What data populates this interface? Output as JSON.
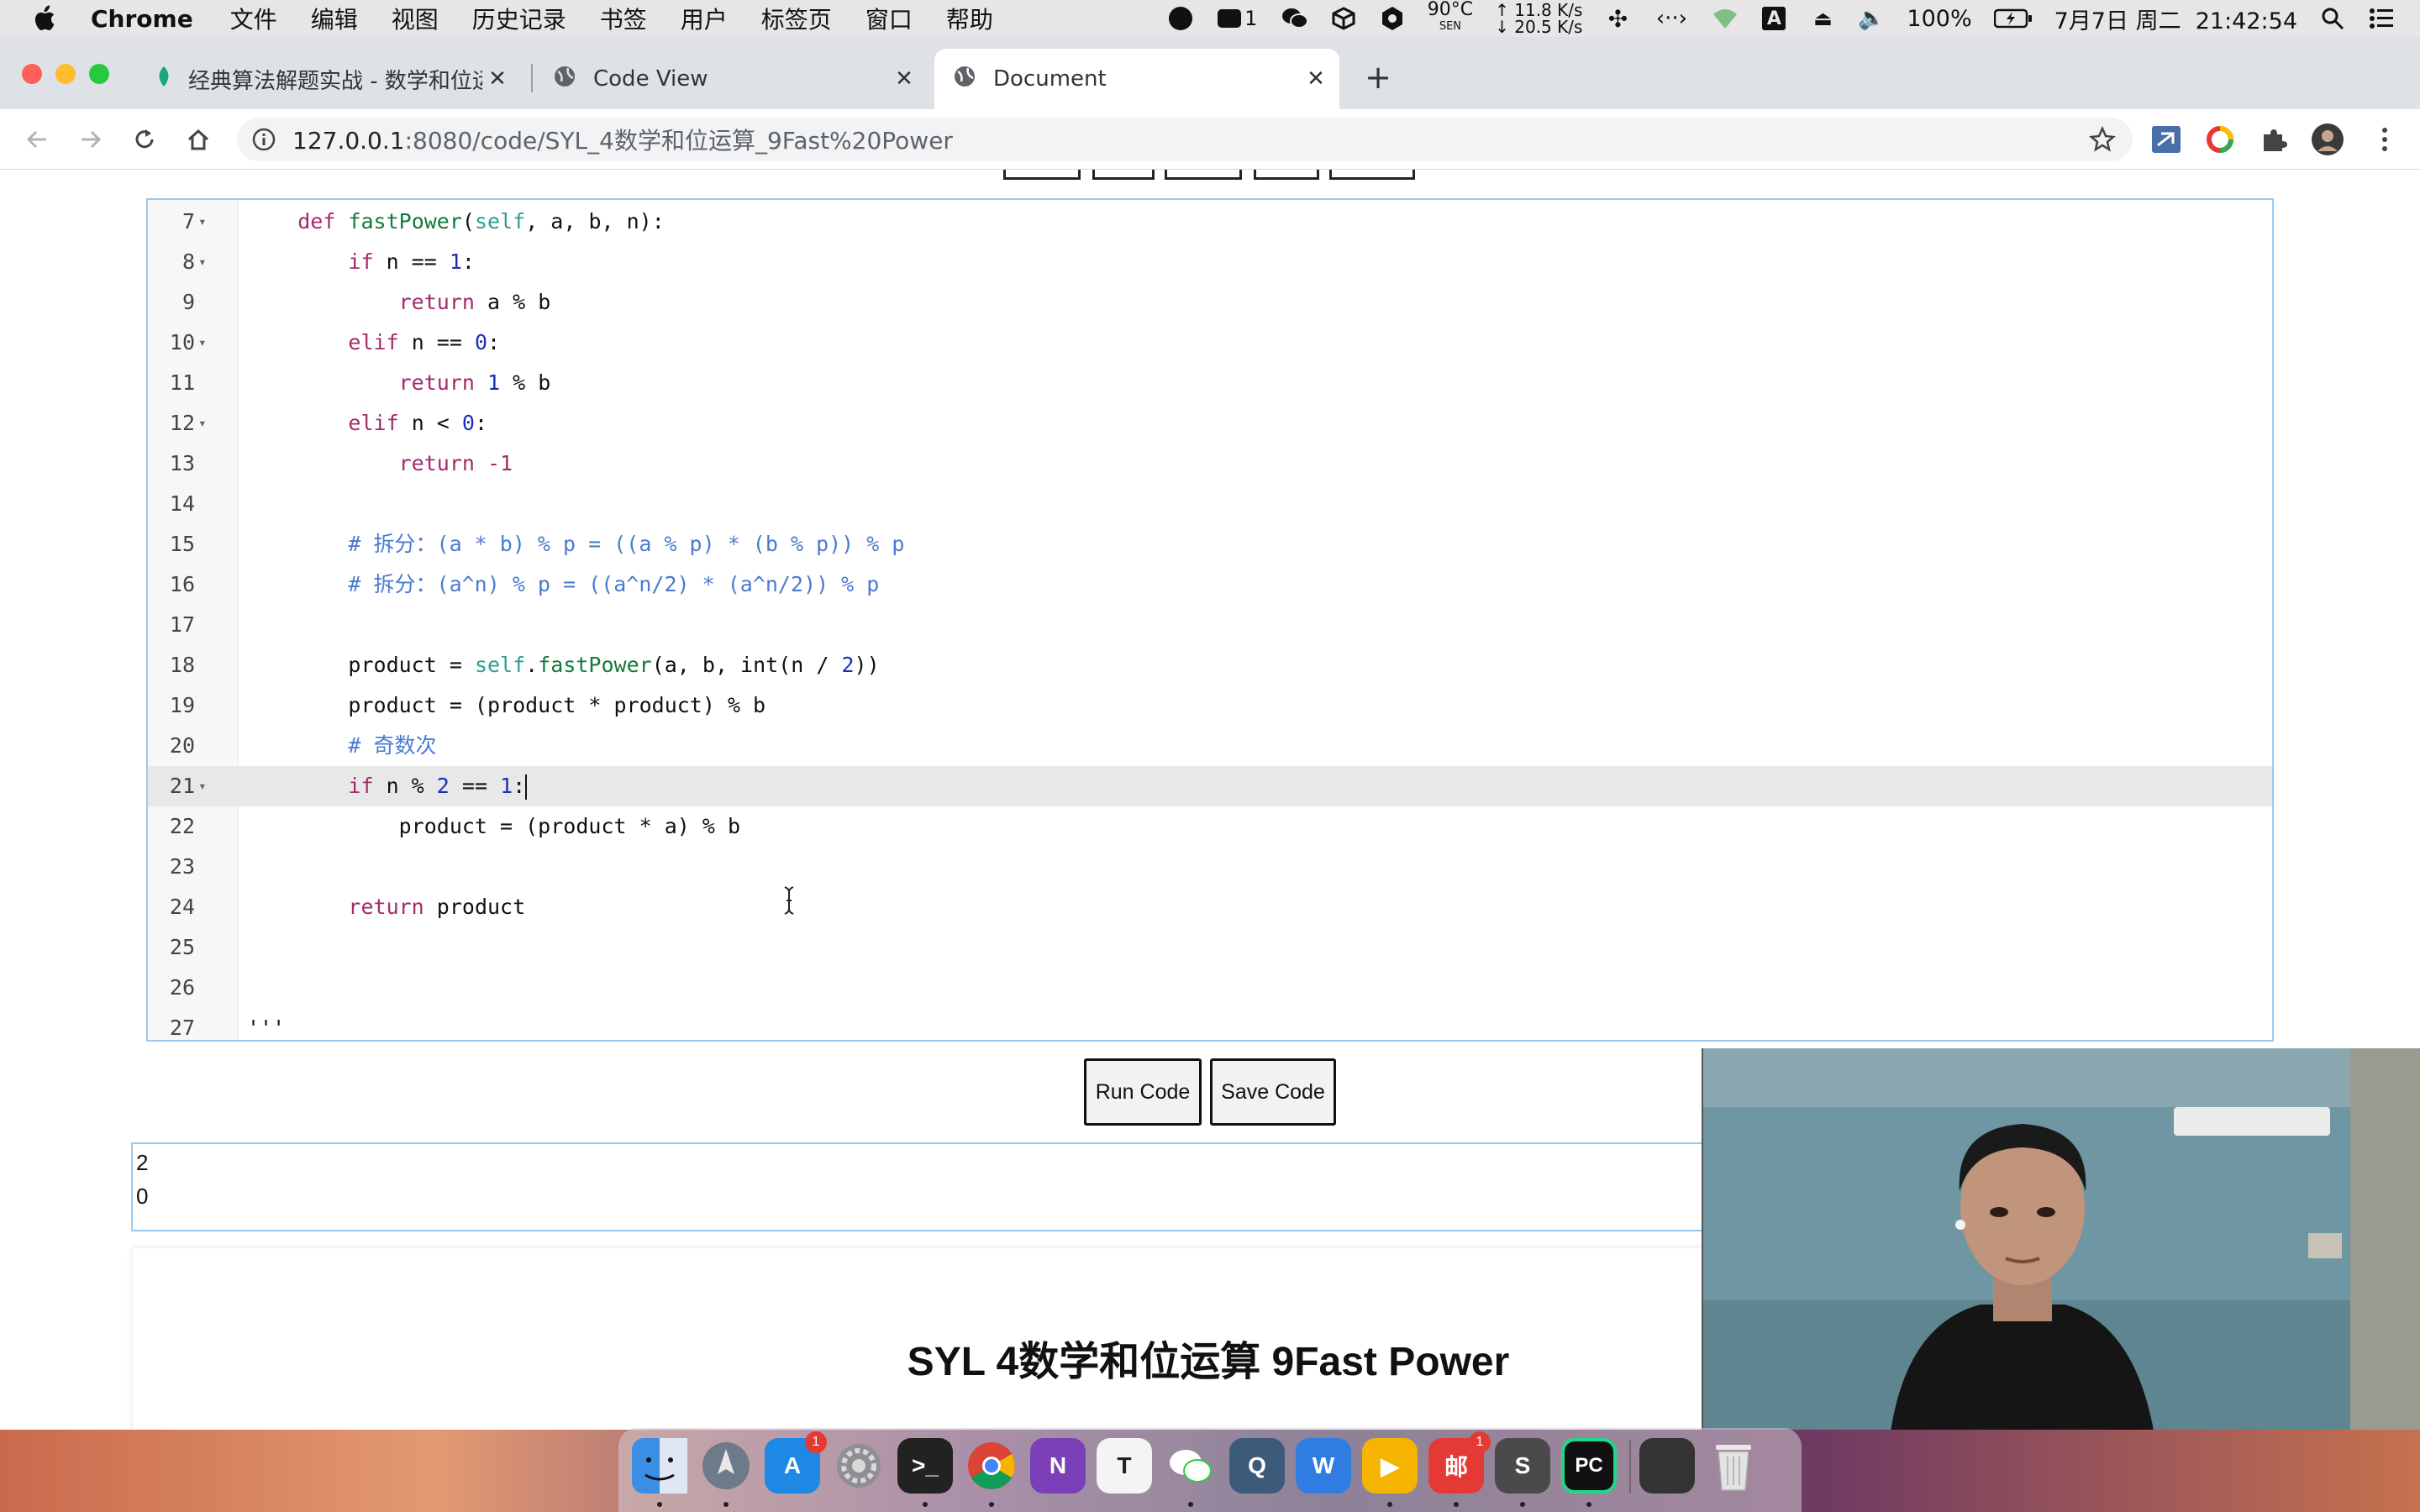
{
  "menubar": {
    "app_name": "Chrome",
    "menus": [
      "文件",
      "编辑",
      "视图",
      "历史记录",
      "书签",
      "用户",
      "标签页",
      "窗口",
      "帮助"
    ],
    "status": {
      "wechat_badge": "1",
      "temperature": "90°C",
      "temp_sensor": "SEN",
      "net_up": "11.8 K/s",
      "net_down": "20.5 K/s",
      "input_method": "A",
      "battery": "100%",
      "datetime": "7月7日 周二  21:42:54"
    }
  },
  "browser": {
    "tabs": [
      {
        "label": "经典算法解题实战 - 数学和位运算",
        "icon": "leaf-icon"
      },
      {
        "label": "Code View",
        "icon": "globe-icon"
      },
      {
        "label": "Document",
        "icon": "globe-icon",
        "active": true
      }
    ],
    "url_host": "127.0.0.1",
    "url_path": ":8080/code/SYL_4数学和位运算_9Fast%20Power"
  },
  "editor": {
    "lines": [
      {
        "n": "7",
        "fold": true,
        "tokens": [
          [
            "",
            "    "
          ],
          [
            "kw",
            "def "
          ],
          [
            "fn",
            "fastPower"
          ],
          [
            "",
            "("
          ],
          [
            "self",
            "self"
          ],
          [
            "",
            ", a, b, n):"
          ]
        ]
      },
      {
        "n": "8",
        "fold": true,
        "tokens": [
          [
            "",
            "        "
          ],
          [
            "kw",
            "if"
          ],
          [
            "",
            " n == "
          ],
          [
            "num",
            "1"
          ],
          [
            "",
            ":"
          ]
        ]
      },
      {
        "n": "9",
        "fold": false,
        "tokens": [
          [
            "",
            "            "
          ],
          [
            "kw",
            "return"
          ],
          [
            "",
            " a % b"
          ]
        ]
      },
      {
        "n": "10",
        "fold": true,
        "tokens": [
          [
            "",
            "        "
          ],
          [
            "kw",
            "elif"
          ],
          [
            "",
            " n == "
          ],
          [
            "num",
            "0"
          ],
          [
            "",
            ":"
          ]
        ]
      },
      {
        "n": "11",
        "fold": false,
        "tokens": [
          [
            "",
            "            "
          ],
          [
            "kw",
            "return "
          ],
          [
            "num",
            "1"
          ],
          [
            "",
            " % b"
          ]
        ]
      },
      {
        "n": "12",
        "fold": true,
        "tokens": [
          [
            "",
            "        "
          ],
          [
            "kw",
            "elif"
          ],
          [
            "",
            " n < "
          ],
          [
            "num",
            "0"
          ],
          [
            "",
            ":"
          ]
        ]
      },
      {
        "n": "13",
        "fold": false,
        "tokens": [
          [
            "",
            "            "
          ],
          [
            "kw",
            "return -1"
          ]
        ]
      },
      {
        "n": "14",
        "fold": false,
        "tokens": []
      },
      {
        "n": "15",
        "fold": false,
        "tokens": [
          [
            "",
            "        "
          ],
          [
            "cm",
            "# 拆分：(a * b) % p = ((a % p) * (b % p)) % p"
          ]
        ]
      },
      {
        "n": "16",
        "fold": false,
        "tokens": [
          [
            "",
            "        "
          ],
          [
            "cm",
            "# 拆分：(a^n) % p = ((a^n/2) * (a^n/2)) % p"
          ]
        ]
      },
      {
        "n": "17",
        "fold": false,
        "tokens": []
      },
      {
        "n": "18",
        "fold": false,
        "tokens": [
          [
            "",
            "        product = "
          ],
          [
            "self",
            "self"
          ],
          [
            "",
            "."
          ],
          [
            "fn",
            "fastPower"
          ],
          [
            "",
            "(a, b, int(n / "
          ],
          [
            "num",
            "2"
          ],
          [
            "",
            "))"
          ]
        ]
      },
      {
        "n": "19",
        "fold": false,
        "tokens": [
          [
            "",
            "        product = (product * product) % b"
          ]
        ]
      },
      {
        "n": "20",
        "fold": false,
        "tokens": [
          [
            "",
            "        "
          ],
          [
            "cm",
            "# 奇数次"
          ]
        ]
      },
      {
        "n": "21",
        "fold": true,
        "active": true,
        "tokens": [
          [
            "",
            "        "
          ],
          [
            "kw",
            "if"
          ],
          [
            "",
            " n % "
          ],
          [
            "num",
            "2"
          ],
          [
            "",
            " == "
          ],
          [
            "num",
            "1"
          ],
          [
            "",
            ":"
          ]
        ]
      },
      {
        "n": "22",
        "fold": false,
        "tokens": [
          [
            "",
            "            product = (product * a) % b"
          ]
        ]
      },
      {
        "n": "23",
        "fold": false,
        "tokens": []
      },
      {
        "n": "24",
        "fold": false,
        "tokens": [
          [
            "",
            "        "
          ],
          [
            "kw",
            "return"
          ],
          [
            "",
            " product"
          ]
        ]
      },
      {
        "n": "25",
        "fold": false,
        "tokens": []
      },
      {
        "n": "26",
        "fold": false,
        "tokens": []
      },
      {
        "n": "27",
        "fold": false,
        "tokens": [
          [
            "",
            "'''"
          ]
        ]
      }
    ]
  },
  "buttons": {
    "run": "Run Code",
    "save": "Save Code"
  },
  "output": {
    "line1": "2",
    "line2": "0"
  },
  "problem": {
    "title": "SYL 4数学和位运算 9Fast Power"
  },
  "dock": {
    "apps": [
      {
        "name": "finder-icon",
        "color": "#3b8ee6",
        "label": ""
      },
      {
        "name": "launchpad-icon",
        "color": "#6c7a89",
        "label": ""
      },
      {
        "name": "app-store-icon",
        "color": "#1e88e5",
        "label": "A",
        "badge": "1"
      },
      {
        "name": "system-preferences-icon",
        "color": "#8e8e93",
        "label": ""
      },
      {
        "name": "terminal-icon",
        "color": "#222222",
        "label": ">_"
      },
      {
        "name": "chrome-icon",
        "color": "#ffffff",
        "label": ""
      },
      {
        "name": "onenote-icon",
        "color": "#7b3fb8",
        "label": "N"
      },
      {
        "name": "typora-icon",
        "color": "#f4f4f4",
        "label": "T"
      },
      {
        "name": "wechat-icon",
        "color": "#2ecc40",
        "label": ""
      },
      {
        "name": "quicktime-icon",
        "color": "#3c5a7a",
        "label": "Q"
      },
      {
        "name": "wps-icon",
        "color": "#2f7de1",
        "label": "W"
      },
      {
        "name": "infuse-icon",
        "color": "#f5b400",
        "label": "▶"
      },
      {
        "name": "mail-app-icon",
        "color": "#e53935",
        "label": "邮",
        "badge": "1"
      },
      {
        "name": "sublime-icon",
        "color": "#4a4a4a",
        "label": "S"
      },
      {
        "name": "pycharm-icon",
        "color": "#111111",
        "label": "PC"
      },
      {
        "name": "pycharm-window-icon",
        "color": "#333333",
        "label": ""
      },
      {
        "name": "trash-icon",
        "color": "#d9d9d9",
        "label": ""
      }
    ]
  },
  "colors": {
    "keyword": "#a52a6a",
    "function": "#127b3b",
    "number": "#1a2fb8",
    "comment": "#4a7bd0",
    "editor_border": "#9cc9ef"
  }
}
